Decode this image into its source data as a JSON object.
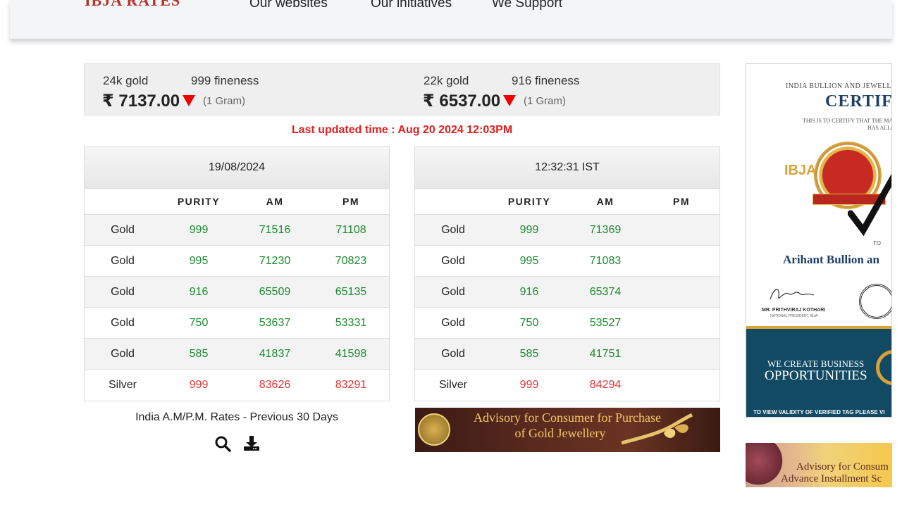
{
  "nav": {
    "logo": "IBJA RATES",
    "items": [
      "Our websites",
      "Our initiatives",
      "We Support"
    ]
  },
  "price_bar": {
    "left": {
      "karat": "24k gold",
      "fineness": "999 fineness",
      "price": "₹ 7137.00",
      "unit": "(1 Gram)",
      "trend": "down"
    },
    "right": {
      "karat": "22k gold",
      "fineness": "916 fineness",
      "price": "₹ 6537.00",
      "unit": "(1 Gram)",
      "trend": "down"
    }
  },
  "last_updated": "Last updated time : Aug 20 2024 12:03PM",
  "table_left": {
    "title": "19/08/2024",
    "columns": [
      "",
      "PURITY",
      "AM",
      "PM"
    ],
    "rows": [
      {
        "metal": "Gold",
        "purity": "999",
        "am": "71516",
        "pm": "71108"
      },
      {
        "metal": "Gold",
        "purity": "995",
        "am": "71230",
        "pm": "70823"
      },
      {
        "metal": "Gold",
        "purity": "916",
        "am": "65509",
        "pm": "65135"
      },
      {
        "metal": "Gold",
        "purity": "750",
        "am": "53637",
        "pm": "53331"
      },
      {
        "metal": "Gold",
        "purity": "585",
        "am": "41837",
        "pm": "41598"
      },
      {
        "metal": "Silver",
        "purity": "999",
        "am": "83626",
        "pm": "83291"
      }
    ]
  },
  "table_right": {
    "title": "12:32:31 IST",
    "columns": [
      "",
      "PURITY",
      "AM",
      "PM"
    ],
    "rows": [
      {
        "metal": "Gold",
        "purity": "999",
        "am": "71369",
        "pm": ""
      },
      {
        "metal": "Gold",
        "purity": "995",
        "am": "71083",
        "pm": ""
      },
      {
        "metal": "Gold",
        "purity": "916",
        "am": "65374",
        "pm": ""
      },
      {
        "metal": "Gold",
        "purity": "750",
        "am": "53527",
        "pm": ""
      },
      {
        "metal": "Gold",
        "purity": "585",
        "am": "41751",
        "pm": ""
      },
      {
        "metal": "Silver",
        "purity": "999",
        "am": "84294",
        "pm": ""
      }
    ]
  },
  "previous_rates_label": "India A.M/P.M. Rates - Previous 30 Days",
  "icons": {
    "search": "search-icon",
    "download": "download-icon"
  },
  "advisory_banner": {
    "line1": "Advisory for Consumer for Purchase",
    "line2": "of Gold Jewellery"
  },
  "certificate": {
    "org": "INDIA BULLION AND JEWELLEF",
    "heading": "CERTIFIC",
    "certify_line": "THIS IS TO CERTIFY THAT THE MAN",
    "allotted_line": "HAS ALLOTTE",
    "ibja": "IBJA",
    "to": "TO",
    "recipient": "Arihant Bullion an",
    "signer": "MR. PRITHVIRAJ KOTHARI",
    "signer_title": "NATIONAL PRESIDENT, IBJA",
    "tagline1": "WE CREATE BUSINESS",
    "tagline2": "OPPORTUNITIES",
    "footer": "TO VIEW VALIDITY OF VERIFIED TAG PLEASE VI"
  },
  "advisory_right": {
    "line1": "Advisory for Consum",
    "line2": "Advance Installment Sc"
  },
  "colors": {
    "down_arrow": "#e00000",
    "gold_value": "#1a8a2e",
    "silver_value": "#e53232",
    "updated_text": "#e02020"
  }
}
